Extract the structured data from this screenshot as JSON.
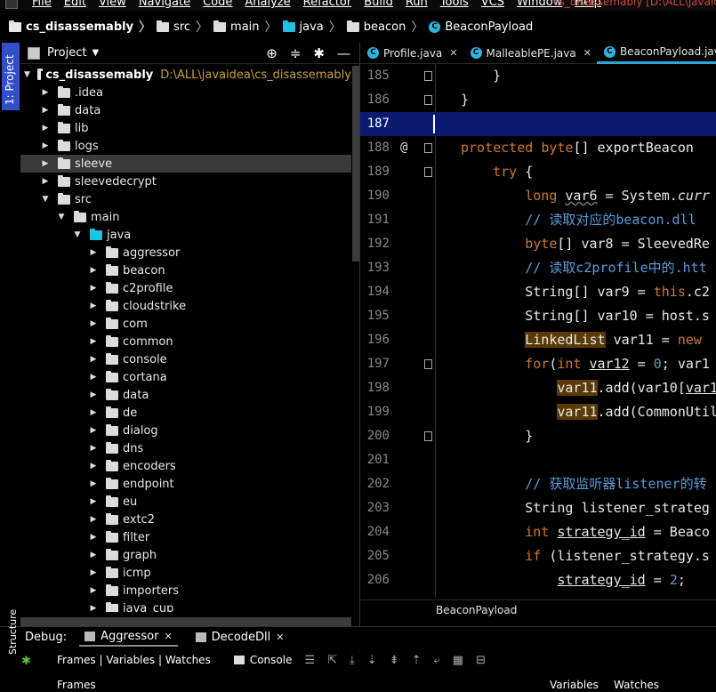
{
  "menubar": {
    "items": [
      "File",
      "Edit",
      "View",
      "Navigate",
      "Code",
      "Analyze",
      "Refactor",
      "Build",
      "Run",
      "Tools",
      "VCS",
      "Window",
      "Help"
    ],
    "window_title": "cs_disassemably [D:\\ALL\\javaide"
  },
  "breadcrumb": {
    "project": "cs_disassemably",
    "src": "src",
    "main": "main",
    "java": "java",
    "beacon": "beacon",
    "cls": "BeaconPayload"
  },
  "stripe": {
    "project_tab": "1: Project",
    "structure_tab": "Structure"
  },
  "project_panel": {
    "title": "Project",
    "root_name": "cs_disassemably",
    "root_path": "D:\\ALL\\javaidea\\cs_disassemably",
    "tree": [
      {
        "label": ".idea",
        "depth": 1
      },
      {
        "label": "data",
        "depth": 1
      },
      {
        "label": "lib",
        "depth": 1
      },
      {
        "label": "logs",
        "depth": 1
      },
      {
        "label": "sleeve",
        "depth": 1,
        "selected": true
      },
      {
        "label": "sleevedecrypt",
        "depth": 1
      },
      {
        "label": "src",
        "depth": 1,
        "open": true
      },
      {
        "label": "main",
        "depth": 2,
        "open": true
      },
      {
        "label": "java",
        "depth": 3,
        "open": true,
        "cyan": true
      },
      {
        "label": "aggressor",
        "depth": 4
      },
      {
        "label": "beacon",
        "depth": 4
      },
      {
        "label": "c2profile",
        "depth": 4
      },
      {
        "label": "cloudstrike",
        "depth": 4
      },
      {
        "label": "com",
        "depth": 4
      },
      {
        "label": "common",
        "depth": 4
      },
      {
        "label": "console",
        "depth": 4
      },
      {
        "label": "cortana",
        "depth": 4
      },
      {
        "label": "data",
        "depth": 4
      },
      {
        "label": "de",
        "depth": 4
      },
      {
        "label": "dialog",
        "depth": 4
      },
      {
        "label": "dns",
        "depth": 4
      },
      {
        "label": "encoders",
        "depth": 4
      },
      {
        "label": "endpoint",
        "depth": 4
      },
      {
        "label": "eu",
        "depth": 4
      },
      {
        "label": "extc2",
        "depth": 4
      },
      {
        "label": "filter",
        "depth": 4
      },
      {
        "label": "graph",
        "depth": 4
      },
      {
        "label": "icmp",
        "depth": 4
      },
      {
        "label": "importers",
        "depth": 4
      },
      {
        "label": "java_cup",
        "depth": 4
      }
    ]
  },
  "editor": {
    "tabs": [
      {
        "label": "Profile.java",
        "active": false
      },
      {
        "label": "MalleablePE.java",
        "active": false
      },
      {
        "label": "BeaconPayload.java",
        "active": true
      }
    ],
    "current_line": "187",
    "breadcrumb": "BeaconPayload",
    "lines": [
      {
        "n": "185",
        "html": "    <span>}</span>"
      },
      {
        "n": "186",
        "html": "<span>}</span>"
      },
      {
        "n": "187",
        "html": ""
      },
      {
        "n": "188",
        "html": "<span class='kw'>protected</span> <span class='kw'>byte</span>[] exportBeacon"
      },
      {
        "n": "189",
        "html": "    <span class='kw'>try</span> {"
      },
      {
        "n": "190",
        "html": "        <span class='kw'>long</span> <span class='uw'>var6</span> = System.<span class='it'>curr</span>"
      },
      {
        "n": "191",
        "html": "        <span class='cm'>// 读取对应的beacon.dll</span>"
      },
      {
        "n": "192",
        "html": "        <span class='kw'>byte</span>[] var8 = SleevedRe"
      },
      {
        "n": "193",
        "html": "        <span class='cm'>// 读取c2profile中的.htt</span>"
      },
      {
        "n": "194",
        "html": "        String[] var9 = <span class='kw'>this</span>.c2"
      },
      {
        "n": "195",
        "html": "        String[] var10 = host.s"
      },
      {
        "n": "196",
        "html": "        <span class='hl'>LinkedList</span> var11 = <span class='kw'>new</span>"
      },
      {
        "n": "197",
        "html": "        <span class='kw'>for</span>(<span class='kw'>int</span> <span class='ul'>var12</span> = <span class='num'>0</span>; var1"
      },
      {
        "n": "198",
        "html": "            <span class='hl'>var11</span>.add(var10[<span class='ul'>var1</span>"
      },
      {
        "n": "199",
        "html": "            <span class='hl'>var11</span>.add(CommonUtil"
      },
      {
        "n": "200",
        "html": "        }"
      },
      {
        "n": "201",
        "html": ""
      },
      {
        "n": "202",
        "html": "        <span class='cm'>// 获取监听器listener的转</span>"
      },
      {
        "n": "203",
        "html": "        String listener_strateg"
      },
      {
        "n": "204",
        "html": "        <span class='kw'>int</span> <span class='ul'>strategy_id</span> = Beaco"
      },
      {
        "n": "205",
        "html": "        <span class='kw'>if</span> (listener_strategy.s"
      },
      {
        "n": "206",
        "html": "            <span class='ul'>strategy_id</span> = <span class='num'>2</span>;"
      }
    ]
  },
  "debug": {
    "label": "Debug:",
    "tabs": [
      "Aggressor",
      "DecodeDll"
    ],
    "frames_vars_watches": "Frames | Variables | Watches",
    "console": "Console",
    "frames": "Frames",
    "variables": "Variables",
    "watches": "Watches"
  }
}
